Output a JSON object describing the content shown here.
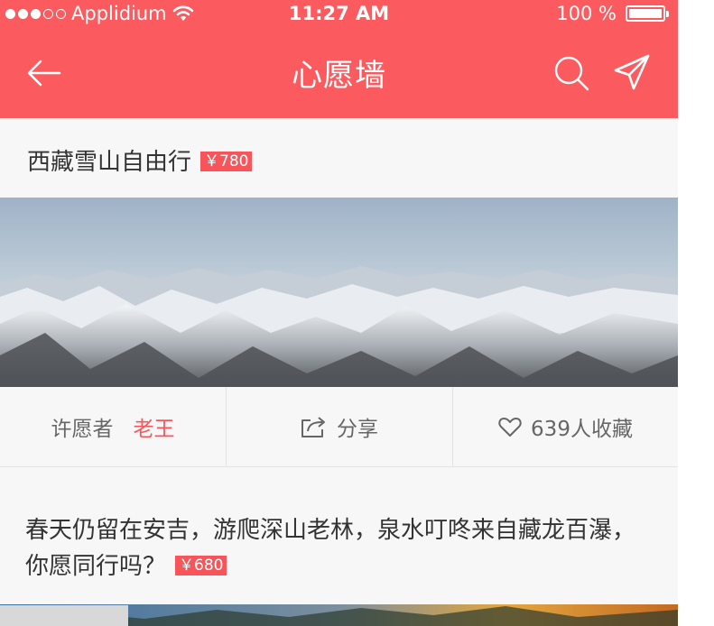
{
  "status": {
    "carrier": "Applidium",
    "time": "11:27 AM",
    "battery": "100 %"
  },
  "nav": {
    "title": "心愿墙"
  },
  "card1": {
    "title": "西藏雪山自由行",
    "price": "￥780",
    "owner_label": "许愿者",
    "owner_name": "老王",
    "share_label": "分享",
    "fav_label": "639人收藏"
  },
  "card2": {
    "title": "春天仍留在安吉，游爬深山老林，泉水叮咚来自藏龙百瀑，你愿同行吗？",
    "price": "￥680"
  },
  "colors": {
    "brand": "#fb5b5f",
    "price_badge": "#f8555b"
  },
  "icons": [
    "signal-dots-icon",
    "wifi-icon",
    "battery-icon",
    "back-arrow-icon",
    "search-icon",
    "send-icon",
    "share-icon",
    "heart-icon"
  ]
}
